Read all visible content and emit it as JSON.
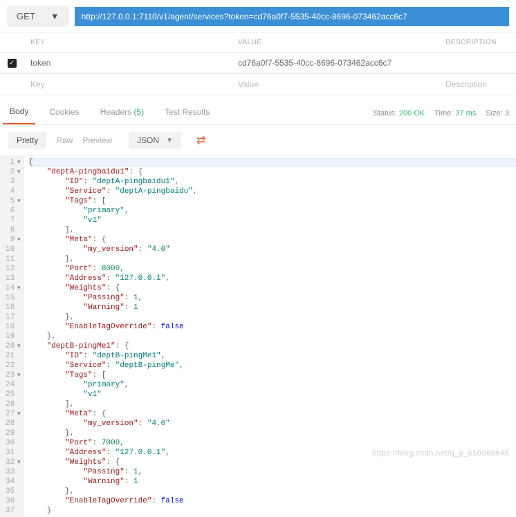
{
  "method": "GET",
  "url": "http://127.0.0.1:7110/v1/agent/services?token=cd76a0f7-5535-40cc-8696-073462acc6c7",
  "params_header": {
    "key": "KEY",
    "value": "VALUE",
    "desc": "DESCRIPTION"
  },
  "params": [
    {
      "checked": true,
      "key": "token",
      "value": "cd76a0f7-5535-40cc-8696-073462acc6c7",
      "desc": ""
    }
  ],
  "param_placeholder": {
    "key": "Key",
    "value": "Value",
    "desc": "Description"
  },
  "tabs": {
    "body": "Body",
    "cookies": "Cookies",
    "headers": "Headers",
    "headers_count": "(5)",
    "test": "Test Results"
  },
  "status": {
    "status_lbl": "Status:",
    "code": "200 OK",
    "time_lbl": "Time:",
    "time": "37 ms",
    "size_lbl": "Size:",
    "size": "3"
  },
  "views": {
    "pretty": "Pretty",
    "raw": "Raw",
    "preview": "Preview",
    "format": "JSON"
  },
  "code_lines": [
    {
      "t": "{",
      "fold": true
    },
    {
      "t": "    \"deptA-pingbaidu1\": {",
      "fold": true
    },
    {
      "t": "        \"ID\": \"deptA-pingbaidu1\","
    },
    {
      "t": "        \"Service\": \"deptA-pingbaidu\","
    },
    {
      "t": "        \"Tags\": [",
      "fold": true
    },
    {
      "t": "            \"primary\","
    },
    {
      "t": "            \"v1\""
    },
    {
      "t": "        ],"
    },
    {
      "t": "        \"Meta\": {",
      "fold": true
    },
    {
      "t": "            \"my_version\": \"4.0\""
    },
    {
      "t": "        },"
    },
    {
      "t": "        \"Port\": 8000,"
    },
    {
      "t": "        \"Address\": \"127.0.0.1\","
    },
    {
      "t": "        \"Weights\": {",
      "fold": true
    },
    {
      "t": "            \"Passing\": 1,"
    },
    {
      "t": "            \"Warning\": 1"
    },
    {
      "t": "        },"
    },
    {
      "t": "        \"EnableTagOverride\": false"
    },
    {
      "t": "    },"
    },
    {
      "t": "    \"deptB-pingMe1\": {",
      "fold": true
    },
    {
      "t": "        \"ID\": \"deptB-pingMe1\","
    },
    {
      "t": "        \"Service\": \"deptB-pingMe\","
    },
    {
      "t": "        \"Tags\": [",
      "fold": true
    },
    {
      "t": "            \"primary\","
    },
    {
      "t": "            \"v1\""
    },
    {
      "t": "        ],"
    },
    {
      "t": "        \"Meta\": {",
      "fold": true
    },
    {
      "t": "            \"my_version\": \"4.0\""
    },
    {
      "t": "        },"
    },
    {
      "t": "        \"Port\": 7000,"
    },
    {
      "t": "        \"Address\": \"127.0.0.1\","
    },
    {
      "t": "        \"Weights\": {",
      "fold": true
    },
    {
      "t": "            \"Passing\": 1,"
    },
    {
      "t": "            \"Warning\": 1"
    },
    {
      "t": "        },"
    },
    {
      "t": "        \"EnableTagOverride\": false"
    },
    {
      "t": "    }"
    }
  ],
  "watermark": "https://blog.csdn.net/q_y_e10965648"
}
